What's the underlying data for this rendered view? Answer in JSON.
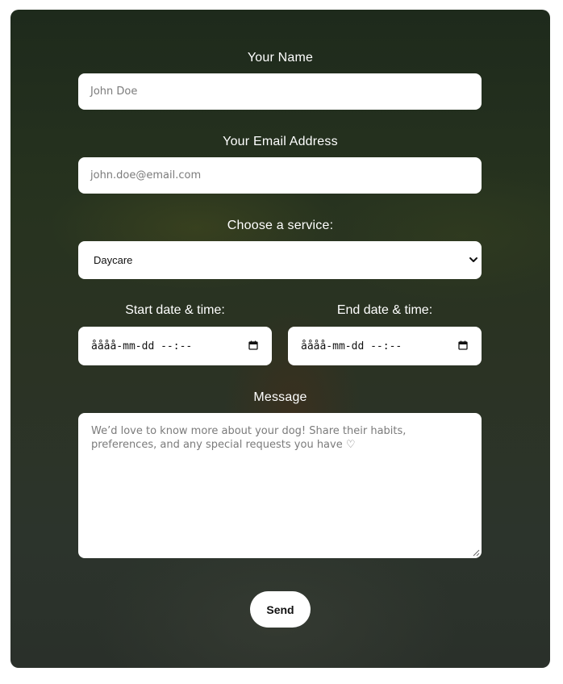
{
  "form": {
    "name": {
      "label": "Your Name",
      "placeholder": "John Doe"
    },
    "email": {
      "label": "Your Email Address",
      "placeholder": "john.doe@email.com"
    },
    "service": {
      "label": "Choose a service:",
      "selected": "Daycare",
      "icon": "chevron-down-icon"
    },
    "start": {
      "label": "Start date & time:",
      "value": "åååå-mm-dd --:--",
      "icon": "calendar-icon"
    },
    "end": {
      "label": "End date & time:",
      "value": "åååå-mm-dd --:--",
      "icon": "calendar-icon"
    },
    "message": {
      "label": "Message",
      "placeholder": "We’d love to know more about your dog! Share their habits, preferences, and any special requests you have ♡"
    },
    "send_label": "Send"
  },
  "colors": {
    "overlay": "#27331f",
    "field_background": "#ffffff",
    "label_text": "#ffffff",
    "placeholder_text": "#7b7b7b"
  }
}
